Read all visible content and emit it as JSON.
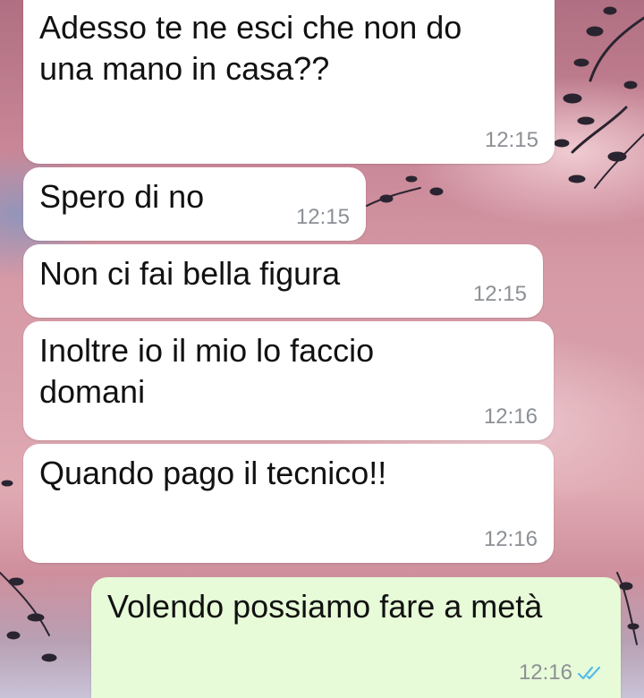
{
  "messages": [
    {
      "direction": "in",
      "text": "Adesso te ne esci che non do una mano in casa??",
      "time": "12:15"
    },
    {
      "direction": "in",
      "text": "Spero di no",
      "time": "12:15"
    },
    {
      "direction": "in",
      "text": "Non ci fai bella figura",
      "time": "12:15"
    },
    {
      "direction": "in",
      "text": "Inoltre io il mio lo faccio domani",
      "time": "12:16"
    },
    {
      "direction": "in",
      "text": "Quando pago il tecnico!!",
      "time": "12:16"
    },
    {
      "direction": "out",
      "text": "Volendo possiamo fare a metà",
      "time": "12:16",
      "status": "read",
      "status_icon": "double-check-icon"
    }
  ],
  "colors": {
    "incoming_bubble": "#ffffff",
    "outgoing_bubble": "#e7fbd8",
    "read_ticks": "#53bdeb",
    "timestamp": "#8c9095"
  }
}
